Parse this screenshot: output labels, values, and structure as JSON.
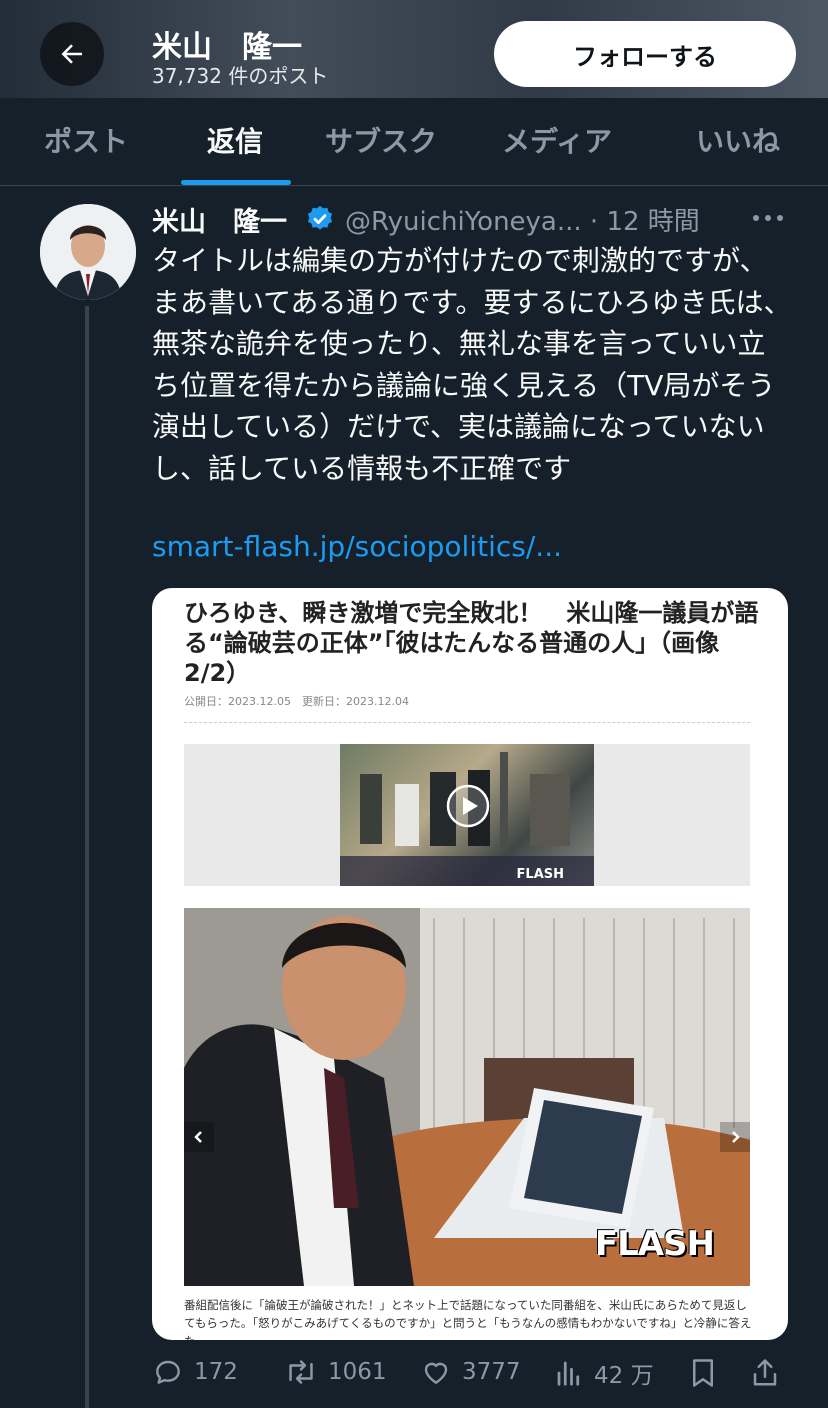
{
  "header": {
    "name": "米山　隆一",
    "post_count": "37,732 件のポスト",
    "follow_label": "フォローする"
  },
  "tabs": [
    "ポスト",
    "返信",
    "サブスク",
    "メディア",
    "いいね"
  ],
  "post": {
    "author_name": "米山　隆一",
    "handle": "@RyuichiYoneya...",
    "time": "· 12 時間",
    "text": "タイトルは編集の方が付けたので刺激的ですが、まあ書いてある通りです。要するにひろゆき氏は、無茶な詭弁を使ったり、無礼な事を言っていい立ち位置を得たから議論に強く見える（TV局がそう演出している）だけで、実は議論になっていないし、話している情報も不正確です",
    "link": "smart-flash.jp/sociopolitics/...",
    "card": {
      "title": "ひろゆき、瞬き激増で完全敗北！　米山隆一議員が語る“論破芸の正体”「彼はたんなる普通の人」（画像2/2）",
      "date": "公開日：2023.12.05　更新日：2023.12.04",
      "video_logo": "FLASH",
      "photo_logo": "FLASH",
      "caption": "番組配信後に「論破王が論破された！」とネット上で話題になっていた同番組を、米山氏にあらためて見返してもらった。「怒りがこみあげてくるものですか」と問うと「もうなんの感情もわかないですね」と冷静に答えた"
    },
    "stats": {
      "replies": "172",
      "reposts": "1061",
      "likes": "3777",
      "views": "42 万"
    }
  },
  "colors": {
    "background": "#15202b",
    "accent": "#1d9bf0",
    "muted": "#8b98a5"
  }
}
